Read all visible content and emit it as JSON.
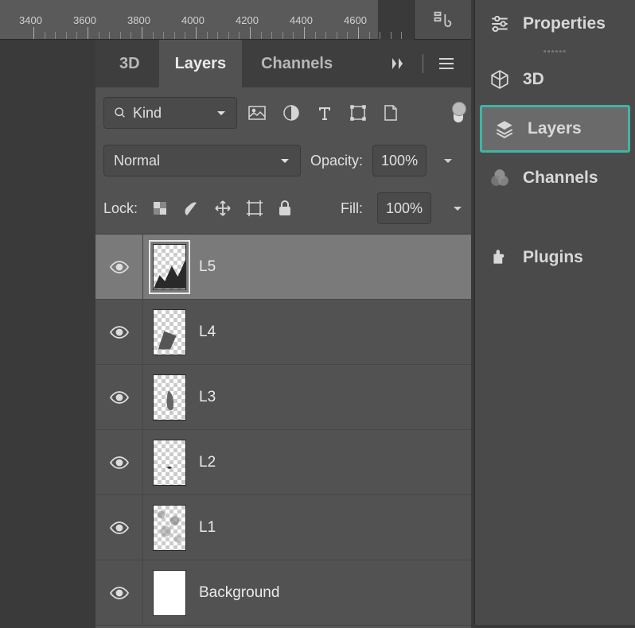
{
  "ruler": {
    "ticks": [
      3400,
      3600,
      3800,
      4000,
      4200,
      4400,
      4600
    ]
  },
  "panel": {
    "tabs": [
      "3D",
      "Layers",
      "Channels"
    ],
    "active_tab": "Layers",
    "filter_kind": "Kind",
    "blend_mode": "Normal",
    "opacity_label": "Opacity:",
    "opacity_value": "100%",
    "lock_label": "Lock:",
    "fill_label": "Fill:",
    "fill_value": "100%"
  },
  "layers": [
    {
      "name": "L5",
      "visible": true,
      "selected": true,
      "thumb": "transparent"
    },
    {
      "name": "L4",
      "visible": true,
      "selected": false,
      "thumb": "transparent"
    },
    {
      "name": "L3",
      "visible": true,
      "selected": false,
      "thumb": "transparent"
    },
    {
      "name": "L2",
      "visible": true,
      "selected": false,
      "thumb": "transparent"
    },
    {
      "name": "L1",
      "visible": true,
      "selected": false,
      "thumb": "transparent"
    },
    {
      "name": "Background",
      "visible": true,
      "selected": false,
      "thumb": "white"
    }
  ],
  "sidebar": {
    "items": [
      {
        "label": "Properties",
        "icon": "sliders"
      },
      {
        "label": "3D",
        "icon": "cube"
      },
      {
        "label": "Layers",
        "icon": "layers",
        "active": true
      },
      {
        "label": "Channels",
        "icon": "rgb"
      },
      {
        "label": "Plugins",
        "icon": "plugin"
      }
    ]
  }
}
